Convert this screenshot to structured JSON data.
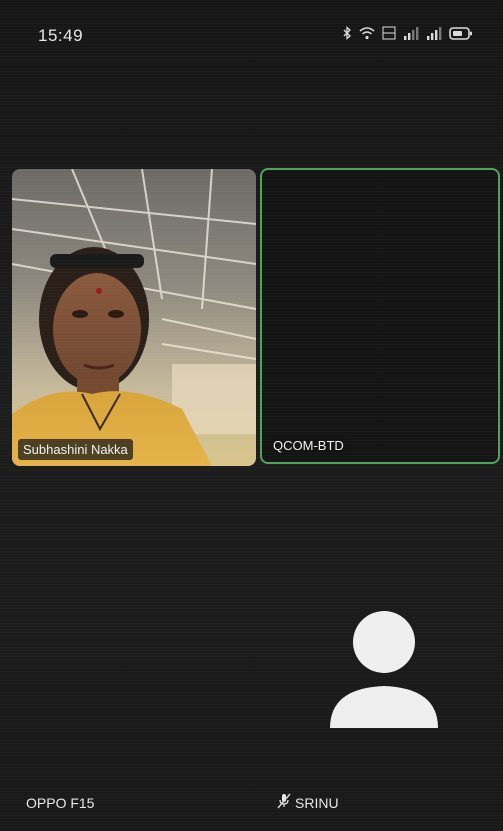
{
  "status_bar": {
    "time": "15:49",
    "icons": [
      "bluetooth-icon",
      "wifi-icon",
      "volte-icon",
      "signal-icon",
      "signal-icon-2",
      "battery-icon"
    ]
  },
  "participants": [
    {
      "name": "Subhashini Nakka",
      "video": "camera-on"
    },
    {
      "name": "QCOM-BTD",
      "video": "camera-off",
      "active_speaker": true
    }
  ],
  "self_view": {
    "device_label": "OPPO F15",
    "muted_user_label": "SRINU"
  },
  "colors": {
    "background": "#1b1b1b",
    "active_speaker_border": "#4ea35a",
    "text": "#f2f2f2"
  }
}
